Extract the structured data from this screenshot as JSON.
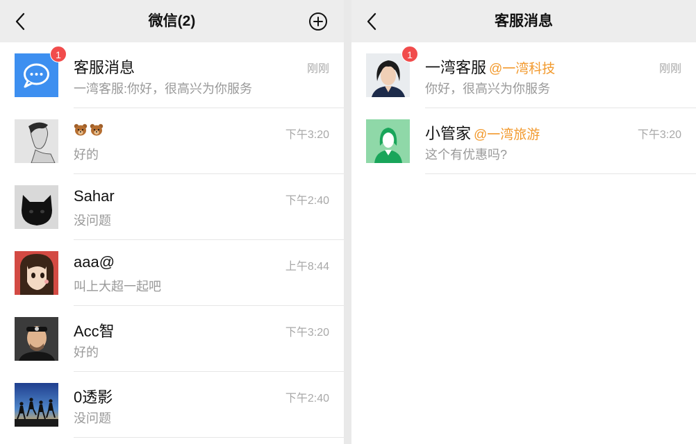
{
  "left": {
    "title": "微信(2)",
    "conversations": [
      {
        "name": "客服消息",
        "time": "刚刚",
        "preview": "一湾客服:你好，很高兴为你服务",
        "badge": "1",
        "avatar": "message-bubble-icon"
      },
      {
        "name": "🐻🐻",
        "time": "下午3:20",
        "preview": "好的",
        "avatar": "sketch-portrait"
      },
      {
        "name": "Sahar",
        "time": "下午2:40",
        "preview": "没问题",
        "avatar": "black-cat"
      },
      {
        "name": "aaa@",
        "time": "上午8:44",
        "preview": "叫上大超一起吧",
        "avatar": "anime-girl"
      },
      {
        "name": "Acc智",
        "time": "下午3:20",
        "preview": "好的",
        "avatar": "man-headband"
      },
      {
        "name": "0透影",
        "time": "下午2:40",
        "preview": "没问题",
        "avatar": "silhouettes-sunset"
      }
    ]
  },
  "right": {
    "title": "客服消息",
    "conversations": [
      {
        "name": "一湾客服",
        "tag": "@一湾科技",
        "time": "刚刚",
        "preview": "你好，很高兴为你服务",
        "badge": "1",
        "avatar": "woman-portrait"
      },
      {
        "name": "小管家",
        "tag": "@一湾旅游",
        "time": "下午3:20",
        "preview": "这个有优惠吗?",
        "avatar": "default-user-icon"
      }
    ]
  },
  "colors": {
    "badge": "#f14c4c",
    "tag": "#f29a2e",
    "nav_bg": "#ededed",
    "message_icon_bg": "#3d8ff0",
    "default_avatar_bg": "#8fd8a8"
  }
}
